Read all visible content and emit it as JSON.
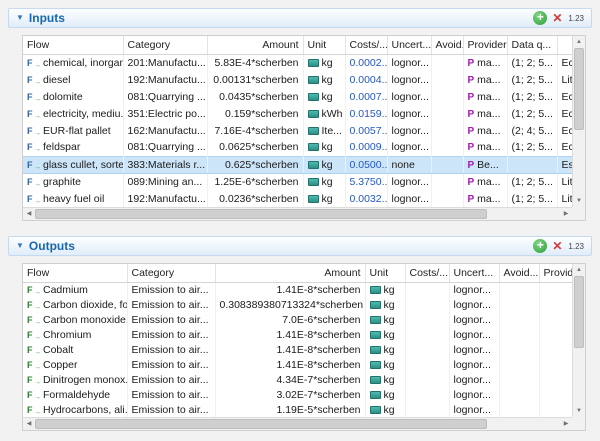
{
  "icons": {
    "collapse": "▼",
    "add": "+",
    "delete": "✕",
    "provider_badge": "P",
    "scroll_up": "▲",
    "scroll_down": "▼",
    "scroll_left": "◀",
    "scroll_right": "▶"
  },
  "inputs": {
    "title": "Inputs",
    "badge": "1.23",
    "columns": [
      {
        "key": "flow",
        "label": "Flow"
      },
      {
        "key": "category",
        "label": "Category"
      },
      {
        "key": "amount",
        "label": "Amount"
      },
      {
        "key": "unit",
        "label": "Unit"
      },
      {
        "key": "costs",
        "label": "Costs/..."
      },
      {
        "key": "uncertainty",
        "label": "Uncert..."
      },
      {
        "key": "avoided",
        "label": "Avoid..."
      },
      {
        "key": "provider",
        "label": "Provider"
      },
      {
        "key": "dq",
        "label": "Data q..."
      },
      {
        "key": "extra",
        "label": ""
      }
    ],
    "rows": [
      {
        "flow": "chemical, inorganic",
        "category": "201:Manufactu...",
        "amount": "5.83E-4*scherben",
        "unit": "kg",
        "costs": "0.0002..",
        "uncertainty": "lognor...",
        "avoided": "",
        "provider": "ma...",
        "dq": "(1; 2; 5...",
        "extra": "Ec",
        "selected": false
      },
      {
        "flow": "diesel",
        "category": "192:Manufactu...",
        "amount": "0.00131*scherben",
        "unit": "kg",
        "costs": "0.0004..",
        "uncertainty": "lognor...",
        "avoided": "",
        "provider": "ma...",
        "dq": "(1; 2; 5...",
        "extra": "Lit",
        "selected": false
      },
      {
        "flow": "dolomite",
        "category": "081:Quarrying ...",
        "amount": "0.0435*scherben",
        "unit": "kg",
        "costs": "0.0007...",
        "uncertainty": "lognor...",
        "avoided": "",
        "provider": "ma...",
        "dq": "(1; 2; 5...",
        "extra": "Ec",
        "selected": false
      },
      {
        "flow": "electricity, mediu...",
        "category": "351:Electric po...",
        "amount": "0.159*scherben",
        "unit": "kWh",
        "costs": "0.0159...",
        "uncertainty": "lognor...",
        "avoided": "",
        "provider": "ma...",
        "dq": "(1; 2; 5...",
        "extra": "Ec",
        "selected": false
      },
      {
        "flow": "EUR-flat pallet",
        "category": "162:Manufactu...",
        "amount": "7.16E-4*scherben",
        "unit": "Ite...",
        "costs": "0.0057...",
        "uncertainty": "lognor...",
        "avoided": "",
        "provider": "ma...",
        "dq": "(2; 4; 5...",
        "extra": "Ec",
        "selected": false
      },
      {
        "flow": "feldspar",
        "category": "081:Quarrying ...",
        "amount": "0.0625*scherben",
        "unit": "kg",
        "costs": "0.0009...",
        "uncertainty": "lognor...",
        "avoided": "",
        "provider": "ma...",
        "dq": "(1; 2; 5...",
        "extra": "Ec",
        "selected": false
      },
      {
        "flow": "glass cullet, sorted",
        "category": "383:Materials r...",
        "amount": "0.625*scherben",
        "unit": "kg",
        "costs": "0.0500...",
        "uncertainty": "none",
        "avoided": "",
        "provider": "Be...",
        "dq": "",
        "extra": "Es",
        "selected": true
      },
      {
        "flow": "graphite",
        "category": "089:Mining an...",
        "amount": "1.25E-6*scherben",
        "unit": "kg",
        "costs": "5.3750...",
        "uncertainty": "lognor...",
        "avoided": "",
        "provider": "ma...",
        "dq": "(1; 2; 5...",
        "extra": "Lit",
        "selected": false
      },
      {
        "flow": "heavy fuel oil",
        "category": "192:Manufactu...",
        "amount": "0.0236*scherben",
        "unit": "kg",
        "costs": "0.0032...",
        "uncertainty": "lognor...",
        "avoided": "",
        "provider": "ma...",
        "dq": "(1; 2; 5...",
        "extra": "Lit",
        "selected": false
      }
    ]
  },
  "outputs": {
    "title": "Outputs",
    "badge": "1.23",
    "columns": [
      {
        "key": "flow",
        "label": "Flow"
      },
      {
        "key": "category",
        "label": "Category"
      },
      {
        "key": "amount",
        "label": "Amount"
      },
      {
        "key": "unit",
        "label": "Unit"
      },
      {
        "key": "costs",
        "label": "Costs/..."
      },
      {
        "key": "uncertainty",
        "label": "Uncert..."
      },
      {
        "key": "avoided",
        "label": "Avoid..."
      },
      {
        "key": "provider",
        "label": "Provider"
      }
    ],
    "rows": [
      {
        "flow": "Cadmium",
        "category": "Emission to air...",
        "amount": "1.41E-8*scherben",
        "unit": "kg",
        "costs": "",
        "uncertainty": "lognor...",
        "avoided": "",
        "provider": "",
        "selected": false
      },
      {
        "flow": "Carbon dioxide, fo...",
        "category": "Emission to air...",
        "amount": "0.308389380713324*scherben",
        "unit": "kg",
        "costs": "",
        "uncertainty": "lognor...",
        "avoided": "",
        "provider": "",
        "selected": false
      },
      {
        "flow": "Carbon monoxide,...",
        "category": "Emission to air...",
        "amount": "7.0E-6*scherben",
        "unit": "kg",
        "costs": "",
        "uncertainty": "lognor...",
        "avoided": "",
        "provider": "",
        "selected": false
      },
      {
        "flow": "Chromium",
        "category": "Emission to air...",
        "amount": "1.41E-8*scherben",
        "unit": "kg",
        "costs": "",
        "uncertainty": "lognor...",
        "avoided": "",
        "provider": "",
        "selected": false
      },
      {
        "flow": "Cobalt",
        "category": "Emission to air...",
        "amount": "1.41E-8*scherben",
        "unit": "kg",
        "costs": "",
        "uncertainty": "lognor...",
        "avoided": "",
        "provider": "",
        "selected": false
      },
      {
        "flow": "Copper",
        "category": "Emission to air...",
        "amount": "1.41E-8*scherben",
        "unit": "kg",
        "costs": "",
        "uncertainty": "lognor...",
        "avoided": "",
        "provider": "",
        "selected": false
      },
      {
        "flow": "Dinitrogen monox...",
        "category": "Emission to air...",
        "amount": "4.34E-7*scherben",
        "unit": "kg",
        "costs": "",
        "uncertainty": "lognor...",
        "avoided": "",
        "provider": "",
        "selected": false
      },
      {
        "flow": "Formaldehyde",
        "category": "Emission to air...",
        "amount": "3.02E-7*scherben",
        "unit": "kg",
        "costs": "",
        "uncertainty": "lognor...",
        "avoided": "",
        "provider": "",
        "selected": false
      },
      {
        "flow": "Hydrocarbons, ali...",
        "category": "Emission to air...",
        "amount": "1.19E-5*scherben",
        "unit": "kg",
        "costs": "",
        "uncertainty": "lognor...",
        "avoided": "",
        "provider": "",
        "selected": false
      }
    ]
  }
}
